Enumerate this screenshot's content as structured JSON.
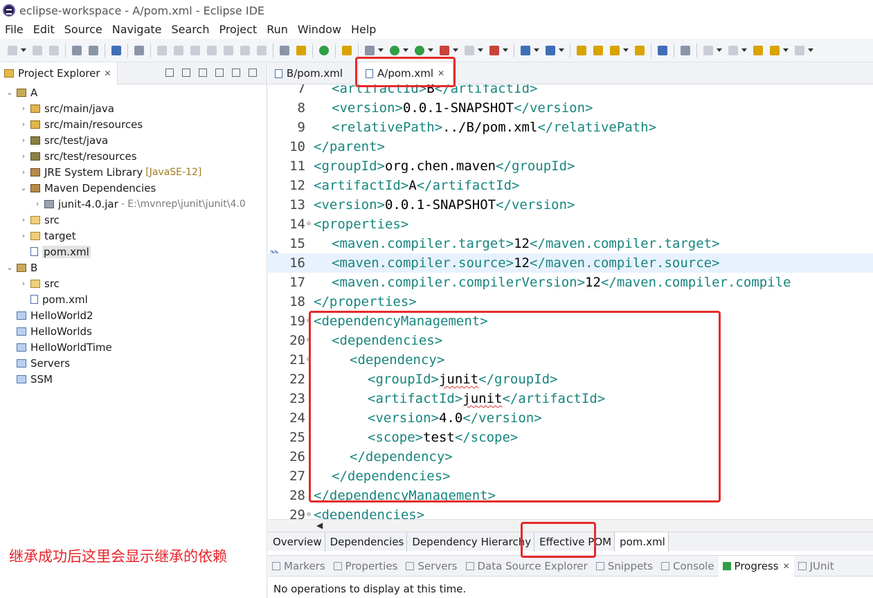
{
  "window": {
    "title": "eclipse-workspace - A/pom.xml - Eclipse IDE"
  },
  "menu": [
    "File",
    "Edit",
    "Source",
    "Navigate",
    "Search",
    "Project",
    "Run",
    "Window",
    "Help"
  ],
  "explorer": {
    "tab_label": "Project Explorer",
    "tree": [
      {
        "label": "A",
        "extra": "",
        "depth": 0,
        "arrow": "down",
        "icon": "project"
      },
      {
        "label": "src/main/java",
        "extra": "",
        "depth": 1,
        "arrow": "right",
        "icon": "srcfolder"
      },
      {
        "label": "src/main/resources",
        "extra": "",
        "depth": 1,
        "arrow": "right",
        "icon": "srcfolder"
      },
      {
        "label": "src/test/java",
        "extra": "",
        "depth": 1,
        "arrow": "right",
        "icon": "testfolder"
      },
      {
        "label": "src/test/resources",
        "extra": "",
        "depth": 1,
        "arrow": "right",
        "icon": "testfolder"
      },
      {
        "label": "JRE System Library",
        "extra": "[JavaSE-12]",
        "depth": 1,
        "arrow": "right",
        "icon": "library"
      },
      {
        "label": "Maven Dependencies",
        "extra": "",
        "depth": 1,
        "arrow": "down",
        "icon": "library"
      },
      {
        "label": "junit-4.0.jar",
        "extra": "- E:\\mvnrep\\junit\\junit\\4.0",
        "depth": 2,
        "arrow": "right",
        "icon": "jar"
      },
      {
        "label": "src",
        "extra": "",
        "depth": 1,
        "arrow": "right",
        "icon": "folder"
      },
      {
        "label": "target",
        "extra": "",
        "depth": 1,
        "arrow": "right",
        "icon": "folder"
      },
      {
        "label": "pom.xml",
        "extra": "",
        "depth": 1,
        "arrow": "",
        "icon": "xmlfile",
        "selected": true
      },
      {
        "label": "B",
        "extra": "",
        "depth": 0,
        "arrow": "down",
        "icon": "project"
      },
      {
        "label": "src",
        "extra": "",
        "depth": 1,
        "arrow": "right",
        "icon": "folder"
      },
      {
        "label": "pom.xml",
        "extra": "",
        "depth": 1,
        "arrow": "",
        "icon": "xmlfile"
      },
      {
        "label": "HelloWorld2",
        "extra": "",
        "depth": 0,
        "arrow": "",
        "icon": "bluefolder"
      },
      {
        "label": "HelloWorlds",
        "extra": "",
        "depth": 0,
        "arrow": "",
        "icon": "bluefolder"
      },
      {
        "label": "HelloWorldTime",
        "extra": "",
        "depth": 0,
        "arrow": "",
        "icon": "bluefolder"
      },
      {
        "label": "Servers",
        "extra": "",
        "depth": 0,
        "arrow": "",
        "icon": "bluefolder"
      },
      {
        "label": "SSM",
        "extra": "",
        "depth": 0,
        "arrow": "",
        "icon": "bluefolder"
      }
    ]
  },
  "annotation": "继承成功后这里会显示继承的依赖",
  "editor": {
    "tabs": [
      {
        "label": "B/pom.xml",
        "active": false
      },
      {
        "label": "A/pom.xml",
        "active": true
      }
    ],
    "highlighted_line": "16",
    "lines": [
      {
        "num": "7",
        "fold": false,
        "indent": 2,
        "parts": [
          [
            "tag",
            "<artifactId>"
          ],
          [
            "txt",
            "B"
          ],
          [
            "tag",
            "</artifactId>"
          ]
        ]
      },
      {
        "num": "8",
        "fold": false,
        "indent": 2,
        "parts": [
          [
            "tag",
            "<version>"
          ],
          [
            "txt",
            "0.0.1-SNAPSHOT"
          ],
          [
            "tag",
            "</version>"
          ]
        ]
      },
      {
        "num": "9",
        "fold": false,
        "indent": 2,
        "parts": [
          [
            "tag",
            "<relativePath>"
          ],
          [
            "txt",
            "../B/pom.xml"
          ],
          [
            "tag",
            "</relativePath>"
          ]
        ]
      },
      {
        "num": "10",
        "fold": false,
        "indent": 1,
        "parts": [
          [
            "tag",
            "</parent>"
          ]
        ]
      },
      {
        "num": "11",
        "fold": false,
        "indent": 1,
        "parts": [
          [
            "tag",
            "<groupId>"
          ],
          [
            "txt",
            "org.chen.maven"
          ],
          [
            "tag",
            "</groupId>"
          ]
        ]
      },
      {
        "num": "12",
        "fold": false,
        "indent": 1,
        "parts": [
          [
            "tag",
            "<artifactId>"
          ],
          [
            "txt",
            "A"
          ],
          [
            "tag",
            "</artifactId>"
          ]
        ]
      },
      {
        "num": "13",
        "fold": false,
        "indent": 1,
        "parts": [
          [
            "tag",
            "<version>"
          ],
          [
            "txt",
            "0.0.1-SNAPSHOT"
          ],
          [
            "tag",
            "</version>"
          ]
        ]
      },
      {
        "num": "14",
        "fold": true,
        "indent": 1,
        "parts": [
          [
            "tag",
            "<properties>"
          ]
        ]
      },
      {
        "num": "15",
        "fold": false,
        "indent": 2,
        "parts": [
          [
            "tag",
            "<maven.compiler.target>"
          ],
          [
            "txt",
            "12"
          ],
          [
            "tag",
            "</maven.compiler.target>"
          ]
        ]
      },
      {
        "num": "16",
        "fold": false,
        "indent": 2,
        "parts": [
          [
            "tag",
            "<maven.compiler.source>"
          ],
          [
            "txt",
            "12"
          ],
          [
            "tag",
            "</maven.compiler.source>"
          ]
        ]
      },
      {
        "num": "17",
        "fold": false,
        "indent": 2,
        "parts": [
          [
            "tag",
            "<maven.compiler.compilerVersion>"
          ],
          [
            "txt",
            "12"
          ],
          [
            "tag",
            "</maven.compiler.compile"
          ]
        ]
      },
      {
        "num": "18",
        "fold": false,
        "indent": 1,
        "parts": [
          [
            "tag",
            "</properties>"
          ]
        ]
      },
      {
        "num": "19",
        "fold": true,
        "indent": 1,
        "parts": [
          [
            "tag",
            "<dependencyManagement>"
          ]
        ]
      },
      {
        "num": "20",
        "fold": true,
        "indent": 2,
        "parts": [
          [
            "tag",
            "<dependencies>"
          ]
        ]
      },
      {
        "num": "21",
        "fold": true,
        "indent": 3,
        "parts": [
          [
            "tag",
            "<dependency>"
          ]
        ]
      },
      {
        "num": "22",
        "fold": false,
        "indent": 4,
        "parts": [
          [
            "tag",
            "<groupId>"
          ],
          [
            "txt-sq",
            "junit"
          ],
          [
            "tag",
            "</groupId>"
          ]
        ]
      },
      {
        "num": "23",
        "fold": false,
        "indent": 4,
        "parts": [
          [
            "tag",
            "<artifactId>"
          ],
          [
            "txt-sq",
            "junit"
          ],
          [
            "tag",
            "</artifactId>"
          ]
        ]
      },
      {
        "num": "24",
        "fold": false,
        "indent": 4,
        "parts": [
          [
            "tag",
            "<version>"
          ],
          [
            "txt",
            "4.0"
          ],
          [
            "tag",
            "</version>"
          ]
        ]
      },
      {
        "num": "25",
        "fold": false,
        "indent": 4,
        "parts": [
          [
            "tag",
            "<scope>"
          ],
          [
            "txt",
            "test"
          ],
          [
            "tag",
            "</scope>"
          ]
        ]
      },
      {
        "num": "26",
        "fold": false,
        "indent": 3,
        "parts": [
          [
            "tag",
            "</dependency>"
          ]
        ]
      },
      {
        "num": "27",
        "fold": false,
        "indent": 2,
        "parts": [
          [
            "tag",
            "</dependencies>"
          ]
        ]
      },
      {
        "num": "28",
        "fold": false,
        "indent": 1,
        "parts": [
          [
            "tag",
            "</dependencyManagement>"
          ]
        ]
      },
      {
        "num": "29",
        "fold": true,
        "indent": 1,
        "parts": [
          [
            "tag",
            "<dependencies>"
          ]
        ]
      }
    ]
  },
  "pom_tabs": [
    {
      "label": "Overview",
      "active": false
    },
    {
      "label": "Dependencies",
      "active": false
    },
    {
      "label": "Dependency Hierarchy",
      "active": false
    },
    {
      "label": "Effective POM",
      "active": false
    },
    {
      "label": "pom.xml",
      "active": true
    }
  ],
  "bottom_views": {
    "tabs": [
      {
        "label": "Markers",
        "active": false,
        "icon": "markers-icon"
      },
      {
        "label": "Properties",
        "active": false,
        "icon": "properties-icon"
      },
      {
        "label": "Servers",
        "active": false,
        "icon": "servers-icon"
      },
      {
        "label": "Data Source Explorer",
        "active": false,
        "icon": "data-source-icon"
      },
      {
        "label": "Snippets",
        "active": false,
        "icon": "snippets-icon"
      },
      {
        "label": "Console",
        "active": false,
        "icon": "console-icon"
      },
      {
        "label": "Progress",
        "active": true,
        "icon": "progress-icon"
      },
      {
        "label": "JUnit",
        "active": false,
        "icon": "junit-icon"
      }
    ],
    "status": "No operations to display at this time."
  },
  "colors": {
    "xml_tag": "#17857e",
    "annotation": "#e8232b",
    "highlight_box": "#e52a2a",
    "current_line": "#e8f2fe"
  }
}
